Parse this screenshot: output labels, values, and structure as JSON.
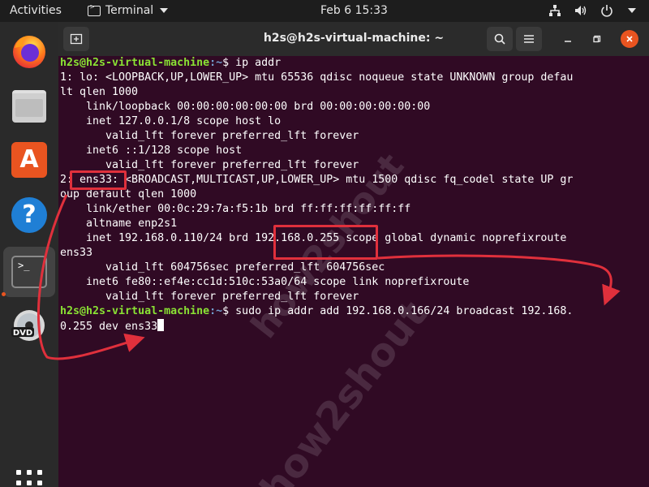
{
  "topbar": {
    "activities": "Activities",
    "app_name": "Terminal",
    "clock": "Feb 6  15:33"
  },
  "dock": {
    "items": [
      "firefox-icon",
      "files-icon",
      "software-store-icon",
      "help-icon",
      "terminal-icon",
      "dvd-icon"
    ],
    "terminal_glyph": ">_",
    "dvd_label": "DVD"
  },
  "window": {
    "title": "h2s@h2s-virtual-machine: ~"
  },
  "terminal": {
    "user_host": "h2s@h2s-virtual-machine",
    "cwd": ":~",
    "lines": {
      "l1_cmd": "$ ip addr",
      "l2": "1: lo: <LOOPBACK,UP,LOWER_UP> mtu 65536 qdisc noqueue state UNKNOWN group defau",
      "l3": "lt qlen 1000",
      "l4": "    link/loopback 00:00:00:00:00:00 brd 00:00:00:00:00:00",
      "l5": "    inet 127.0.0.1/8 scope host lo",
      "l6": "       valid_lft forever preferred_lft forever",
      "l7": "    inet6 ::1/128 scope host",
      "l8": "       valid_lft forever preferred_lft forever",
      "l9": "2: ens33: <BROADCAST,MULTICAST,UP,LOWER_UP> mtu 1500 qdisc fq_codel state UP gr",
      "l10": "oup default qlen 1000",
      "l11": "    link/ether 00:0c:29:7a:f5:1b brd ff:ff:ff:ff:ff:ff",
      "l12": "    altname enp2s1",
      "l13": "    inet 192.168.0.110/24 brd 192.168.0.255 scope global dynamic noprefixroute",
      "l14": "ens33",
      "l15": "       valid_lft 604756sec preferred_lft 604756sec",
      "l16": "    inet6 fe80::ef4e:cc1d:510c:53a0/64 scope link noprefixroute",
      "l17": "       valid_lft forever preferred_lft forever",
      "l18_cmd": "$ sudo ip addr add 192.168.0.166/24 broadcast 192.168.",
      "l19": "0.255 dev ens33"
    }
  },
  "annotations": {
    "highlight_color": "#e0303c"
  },
  "watermark": "how2shout"
}
